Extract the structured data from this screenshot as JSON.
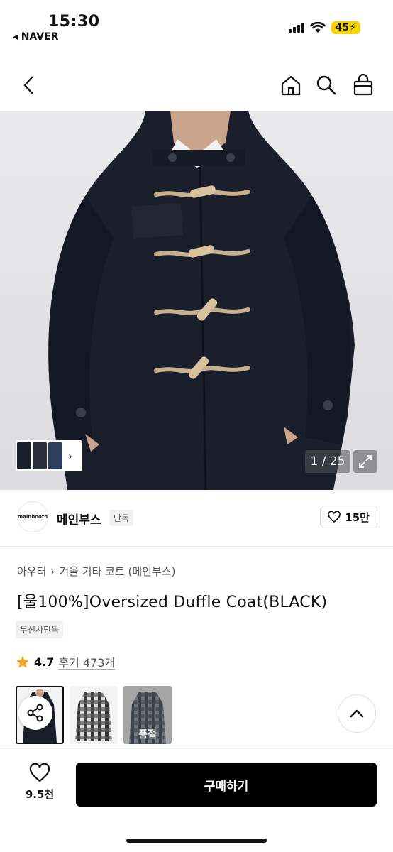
{
  "status_bar": {
    "time": "15:30",
    "back_app": "NAVER",
    "battery": "45"
  },
  "hero": {
    "counter": "1 / 25"
  },
  "brand": {
    "logo_text": "mainbooth",
    "name": "메인부스",
    "tag": "단독",
    "likes": "15만"
  },
  "product": {
    "breadcrumb": [
      "아우터",
      "겨울 기타 코트 (메인부스)"
    ],
    "title": "[울100%]Oversized Duffle Coat(BLACK)",
    "exclusive_badge": "무신사단독",
    "rating": "4.7",
    "reviews": "후기 473개"
  },
  "variants": {
    "soldout_label": "품절"
  },
  "bottom_bar": {
    "wish_count": "9.5천",
    "buy_label": "구매하기"
  },
  "colors": {
    "accent_star": "#f5a623",
    "battery": "#f5d300",
    "primary_button": "#000000"
  }
}
